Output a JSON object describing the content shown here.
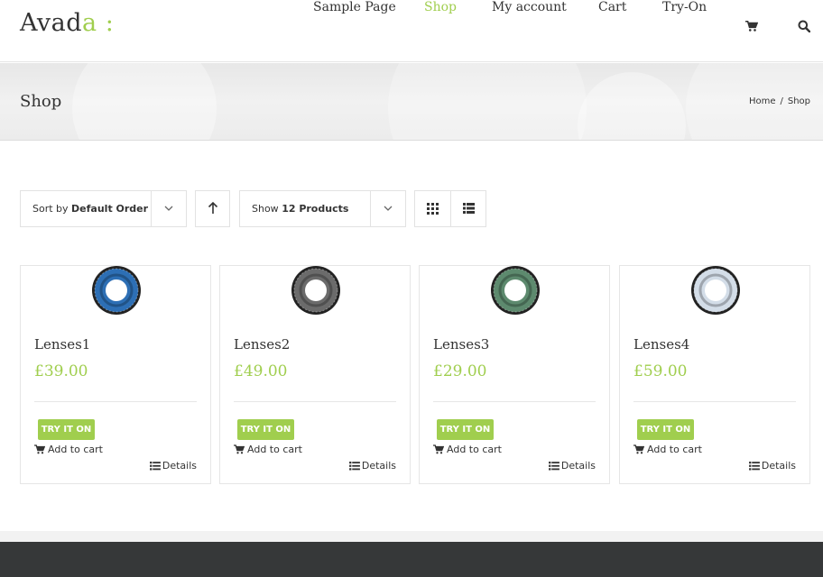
{
  "header": {
    "logo_text": "Avada",
    "logo_accent": "a",
    "logo_colon": ":",
    "nav": [
      {
        "label": "Sample Page"
      },
      {
        "label": "Shop"
      },
      {
        "label": "My account"
      },
      {
        "label": "Cart"
      },
      {
        "label": "Try-On"
      }
    ],
    "active_nav": "Shop",
    "icons": [
      "cart-icon",
      "search-icon"
    ]
  },
  "titlebar": {
    "title": "Shop",
    "breadcrumb": {
      "home": "Home",
      "separator": "/",
      "current": "Shop"
    }
  },
  "toolbar": {
    "sort_prefix": "Sort by",
    "sort_value": "Default Order",
    "show_prefix": "Show",
    "show_value": "12 Products",
    "icons": [
      "chevron-down-icon",
      "arrow-up-icon",
      "grid-view-icon",
      "list-view-icon"
    ]
  },
  "products": [
    {
      "name": "Lenses1",
      "price": "£39.00",
      "try_label": "TRY IT ON",
      "cart_label": "Add to cart",
      "details_label": "Details",
      "color": "#2d6fb5"
    },
    {
      "name": "Lenses2",
      "price": "£49.00",
      "try_label": "TRY IT ON",
      "cart_label": "Add to cart",
      "details_label": "Details",
      "color": "#6b6b6b"
    },
    {
      "name": "Lenses3",
      "price": "£29.00",
      "try_label": "TRY IT ON",
      "cart_label": "Add to cart",
      "details_label": "Details",
      "color": "#5d8a6e"
    },
    {
      "name": "Lenses4",
      "price": "£59.00",
      "try_label": "TRY IT ON",
      "cart_label": "Add to cart",
      "details_label": "Details",
      "color": "#d3dde8"
    }
  ],
  "colors": {
    "accent": "#a0ce4e",
    "footer": "#363839",
    "text": "#333333"
  }
}
